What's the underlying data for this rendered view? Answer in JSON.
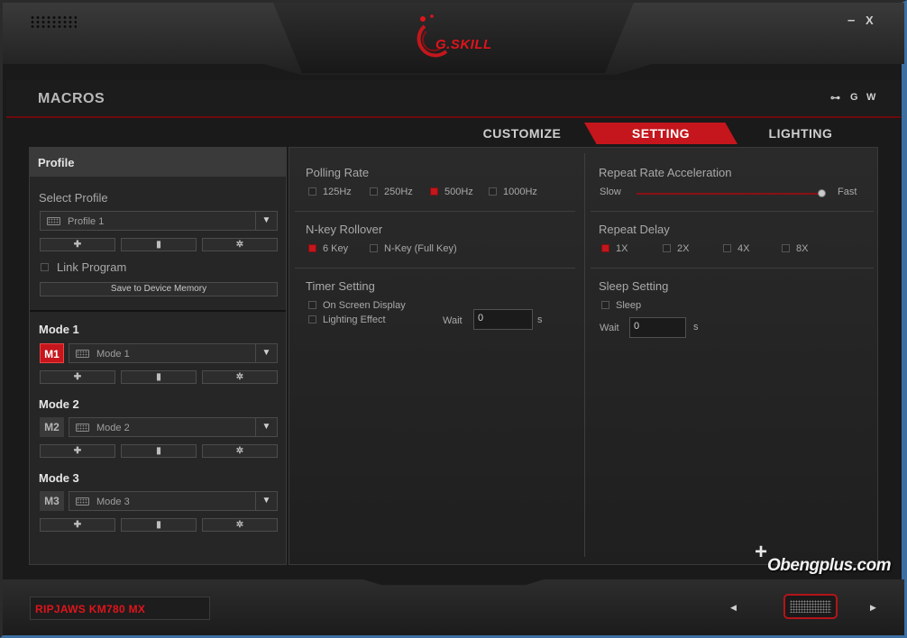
{
  "window": {
    "brand": "G.SKILL",
    "minimize": "–",
    "close": "X"
  },
  "header": {
    "title": "MACROS",
    "icons": [
      {
        "name": "usb-icon",
        "glyph": "⊶"
      },
      {
        "name": "g-icon",
        "glyph": "G"
      },
      {
        "name": "w-icon",
        "glyph": "W"
      }
    ]
  },
  "tabs": [
    {
      "label": "CUSTOMIZE",
      "active": false
    },
    {
      "label": "SETTING",
      "active": true
    },
    {
      "label": "LIGHTING",
      "active": false
    }
  ],
  "sidebar": {
    "profile_title": "Profile",
    "select_profile_label": "Select Profile",
    "profile_selected": "Profile 1",
    "buttons": {
      "add": "✚",
      "delete": "▮",
      "settings": "✲"
    },
    "link_program_label": "Link Program",
    "link_program_checked": false,
    "save_label": "Save to Device Memory",
    "modes": [
      {
        "title": "Mode 1",
        "badge": "M1",
        "selected": "Mode 1",
        "active": true
      },
      {
        "title": "Mode 2",
        "badge": "M2",
        "selected": "Mode 2",
        "active": false
      },
      {
        "title": "Mode 3",
        "badge": "M3",
        "selected": "Mode 3",
        "active": false
      }
    ]
  },
  "settings": {
    "polling_rate": {
      "title": "Polling Rate",
      "options": [
        "125Hz",
        "250Hz",
        "500Hz",
        "1000Hz"
      ],
      "selected": "500Hz"
    },
    "nkey_rollover": {
      "title": "N-key Rollover",
      "options": [
        "6 Key",
        "N-Key (Full Key)"
      ],
      "selected": "6 Key"
    },
    "timer_setting": {
      "title": "Timer Setting",
      "options": [
        "On Screen Display",
        "Lighting Effect"
      ],
      "wait_label": "Wait",
      "wait_value": "0",
      "unit": "s"
    },
    "repeat_rate_acceleration": {
      "title": "Repeat Rate Acceleration",
      "slow_label": "Slow",
      "fast_label": "Fast",
      "level": 1.0
    },
    "repeat_delay": {
      "title": "Repeat Delay",
      "options": [
        "1X",
        "2X",
        "4X",
        "8X"
      ],
      "selected": "1X"
    },
    "sleep_setting": {
      "title": "Sleep Setting",
      "option": "Sleep",
      "wait_label": "Wait",
      "wait_value": "0",
      "unit": "s"
    }
  },
  "footer": {
    "device_name": "RIPJAWS KM780 MX",
    "prev": "◀",
    "next": "▶"
  },
  "watermark": {
    "plus": "+",
    "text": "Obengplus.com"
  },
  "colors": {
    "accent": "#c4161c",
    "brand_red": "#e0141b"
  }
}
